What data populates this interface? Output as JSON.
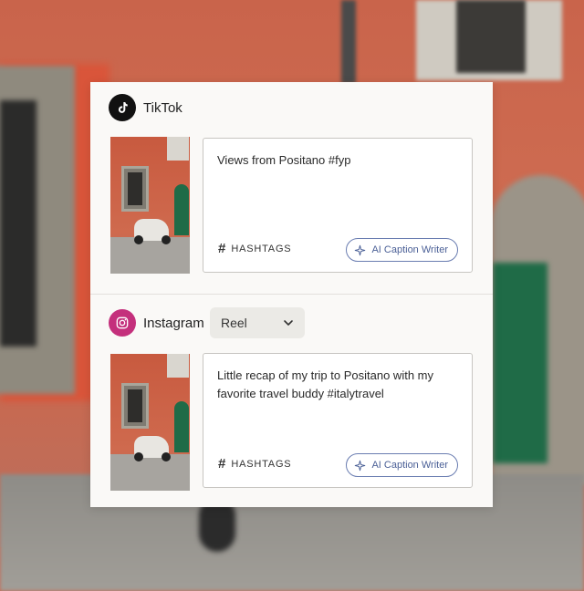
{
  "composer": {
    "networks": [
      {
        "name": "TikTok",
        "icon": "tiktok-icon",
        "caption": "Views from Positano #fyp",
        "hashtags_label": "HASHTAGS",
        "ai_button_label": "AI Caption Writer"
      },
      {
        "name": "Instagram",
        "icon": "instagram-icon",
        "format": "Reel",
        "caption": "Little recap of my trip to Positano with my favorite travel buddy #italytravel",
        "hashtags_label": "HASHTAGS",
        "ai_button_label": "AI Caption Writer"
      }
    ]
  },
  "colors": {
    "tiktok": "#111111",
    "instagram": "#c4307c",
    "ai_accent": "#4a5f96"
  }
}
